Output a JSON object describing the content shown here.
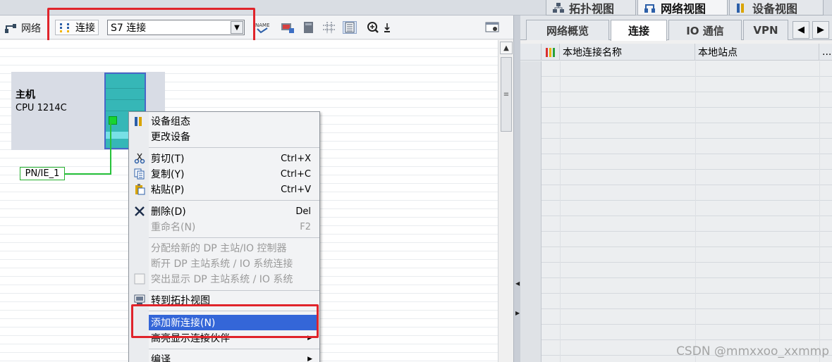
{
  "view_tabs": [
    {
      "label": "拓扑视图"
    },
    {
      "label": "网络视图"
    },
    {
      "label": "设备视图"
    }
  ],
  "toolbar": {
    "network_label": "网络",
    "connect_label": "连接",
    "connection_type": "S7 连接"
  },
  "device": {
    "name": "主机",
    "cpu": "CPU 1214C"
  },
  "network_label": "PN/IE_1",
  "context_menu": {
    "device_config": "设备组态",
    "change_device": "更改设备",
    "cut": "剪切(T)",
    "cut_shortcut": "Ctrl+X",
    "copy": "复制(Y)",
    "copy_shortcut": "Ctrl+C",
    "paste": "粘贴(P)",
    "paste_shortcut": "Ctrl+V",
    "delete": "删除(D)",
    "delete_shortcut": "Del",
    "rename": "重命名(N)",
    "rename_shortcut": "F2",
    "assign_dp": "分配给新的 DP 主站/IO 控制器",
    "disconnect_dp": "断开 DP 主站系统 / IO 系统连接",
    "highlight_dp": "突出显示 DP 主站系统 / IO 系统",
    "goto_topology": "转到拓扑视图",
    "add_connection": "添加新连接(N)",
    "highlight_partner": "高亮显示连接伙伴",
    "compile": "编译"
  },
  "right_tabs": [
    {
      "label": "网络概览"
    },
    {
      "label": "连接"
    },
    {
      "label": "IO 通信"
    },
    {
      "label": "VPN"
    }
  ],
  "right_table": {
    "col_local_name": "本地连接名称",
    "col_local_station": "本地站点",
    "col_more": "..."
  },
  "watermark": "CSDN @mmxxoo_xxmmp",
  "colors": {
    "highlight_red": "#e0242b",
    "selection_blue": "#3466d8",
    "network_green": "#27c23a",
    "module_teal": "#36b7b7"
  }
}
